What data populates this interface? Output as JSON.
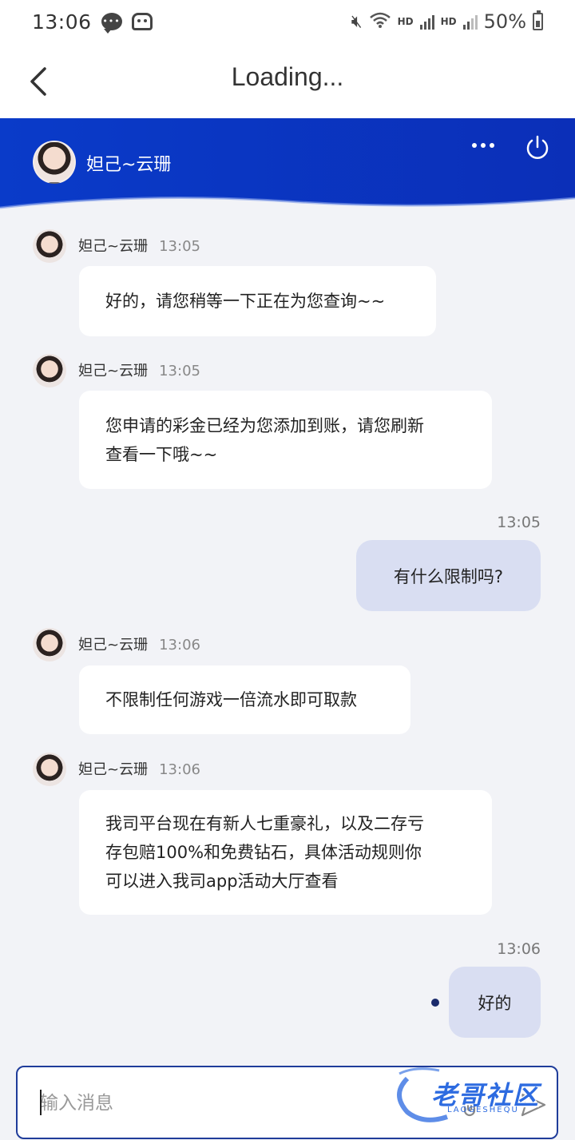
{
  "status_bar": {
    "time": "13:06",
    "network_label_1": "HD",
    "network_label_2": "HD",
    "battery_percent": "50%"
  },
  "app_bar": {
    "title": "Loading..."
  },
  "chat_header": {
    "agent_name": "妲己~云珊"
  },
  "messages": [
    {
      "sender": "agent",
      "name": "妲己~云珊",
      "time": "13:05",
      "lines": [
        "好的，请您稍等一下正在为您查询~~"
      ]
    },
    {
      "sender": "agent",
      "name": "妲己~云珊",
      "time": "13:05",
      "lines": [
        "您申请的彩金已经为您添加到账，请您刷新",
        "查看一下哦~~"
      ]
    },
    {
      "sender": "user",
      "time": "13:05",
      "lines": [
        "有什么限制吗?"
      ]
    },
    {
      "sender": "agent",
      "name": "妲己~云珊",
      "time": "13:06",
      "lines": [
        "不限制任何游戏一倍流水即可取款"
      ]
    },
    {
      "sender": "agent",
      "name": "妲己~云珊",
      "time": "13:06",
      "lines": [
        "我司平台现在有新人七重豪礼，以及二存亏",
        "存包赔100%和免费钻石，具体活动规则你",
        "可以进入我司app活动大厅查看"
      ]
    },
    {
      "sender": "user",
      "time": "13:06",
      "lines": [
        "好的"
      ],
      "status": "sending"
    }
  ],
  "input_bar": {
    "placeholder": "输入消息"
  },
  "watermark": {
    "text": "老哥社区",
    "subtext": "LAOGESHEQU"
  },
  "colors": {
    "header_blue": "#0a3bc9",
    "user_bubble": "#d9def2",
    "agent_bubble": "#ffffff",
    "background": "#f2f3f7"
  }
}
